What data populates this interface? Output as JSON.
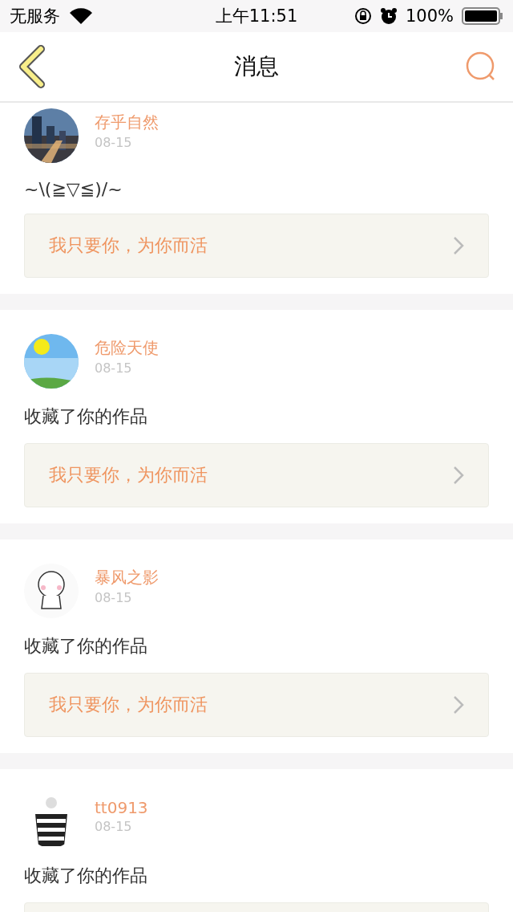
{
  "status_bar": {
    "carrier": "无服务",
    "time": "上午11:51",
    "battery": "100%"
  },
  "nav": {
    "title": "消息"
  },
  "messages": [
    {
      "kind": "quoted",
      "name": "存乎自然",
      "date": "08-15",
      "text": "~\\(≧▽≦)/~",
      "quote": "我只要你，为你而活"
    },
    {
      "kind": "quoted",
      "name": "危险天使",
      "date": "08-15",
      "text": "收藏了你的作品",
      "quote": "我只要你，为你而活"
    },
    {
      "kind": "quoted",
      "name": "暴风之影",
      "date": "08-15",
      "text": "收藏了你的作品",
      "quote": "我只要你，为你而活"
    },
    {
      "kind": "cut-off",
      "name": "tt0913",
      "date": "08-15",
      "text": "收藏了你的作品"
    }
  ]
}
